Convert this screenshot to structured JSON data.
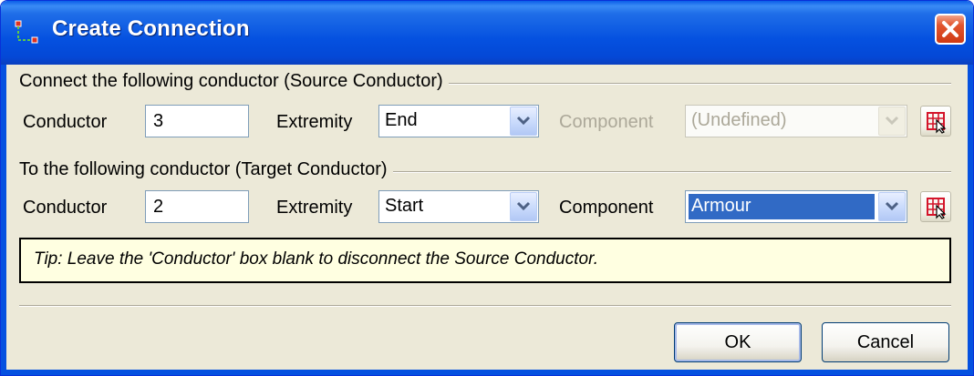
{
  "window": {
    "title": "Create Connection",
    "title_bar_color": "#0551e0",
    "close_button_color": "#e2562f",
    "icons": {
      "app": "connection-icon",
      "close": "close-icon"
    }
  },
  "source_section": {
    "title": "Connect the following conductor (Source Conductor)",
    "conductor_label": "Conductor",
    "conductor_value": "3",
    "extremity_label": "Extremity",
    "extremity_value": "End",
    "component_label": "Component",
    "component_value": "(Undefined)",
    "component_enabled": false
  },
  "target_section": {
    "title": "To the following conductor (Target Conductor)",
    "conductor_label": "Conductor",
    "conductor_value": "2",
    "extremity_label": "Extremity",
    "extremity_value": "Start",
    "component_label": "Component",
    "component_value": "Armour",
    "component_enabled": true
  },
  "tip": "Tip: Leave the 'Conductor' box blank to disconnect the Source Conductor.",
  "buttons": {
    "ok": "OK",
    "cancel": "Cancel"
  },
  "pick_icon": "pick-conductor-icon",
  "selection_color": "#316ac5",
  "tip_background": "#ffffe1"
}
